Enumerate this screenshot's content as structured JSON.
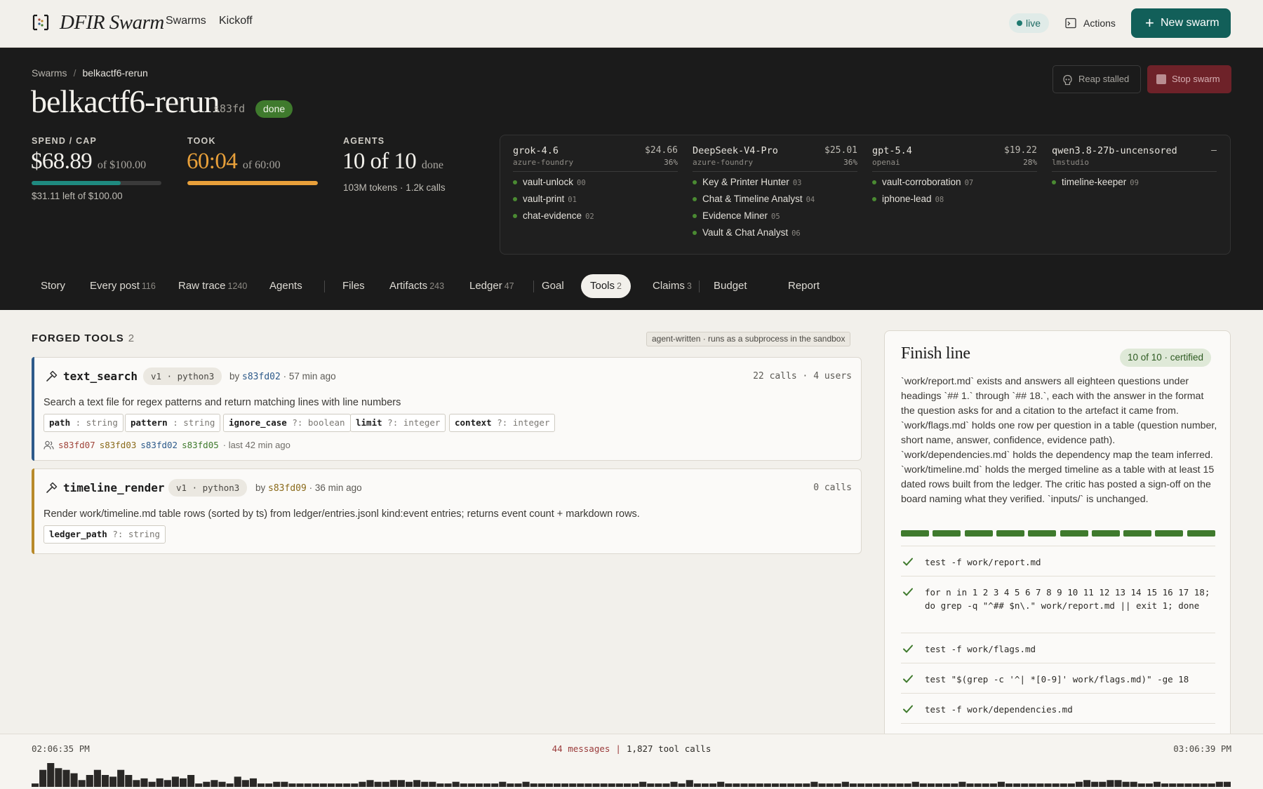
{
  "topbar": {
    "app_title": "DFIR Swarm",
    "nav": [
      "Swarms",
      "Kickoff"
    ],
    "live_label": "live",
    "actions_label": "Actions",
    "new_swarm_label": "New swarm"
  },
  "hero": {
    "breadcrumb": {
      "root": "Swarms",
      "sep": "/",
      "current": "belkactf6-rerun"
    },
    "title": "belkactf6-rerun",
    "swarm_id": "s83fd",
    "status": "done",
    "reap_label": "Reap stalled",
    "stop_label": "Stop swarm",
    "spend": {
      "label": "SPEND / CAP",
      "value": "$68.89",
      "of": "of $100.00",
      "sub": "$31.11 left of $100.00",
      "fraction": 0.6889,
      "color": "#1f8a80"
    },
    "took": {
      "label": "TOOK",
      "value": "60:04",
      "of": "of 60:00",
      "fraction": 1.0,
      "color": "#e8a03a"
    },
    "agents": {
      "label": "AGENTS",
      "value": "10 of 10",
      "of": "done",
      "sub": "103M tokens · 1.2k calls"
    },
    "providers": [
      {
        "name": "grok-4.6",
        "source": "azure-foundry",
        "cost": "$24.66",
        "pct": "36%",
        "agents": [
          {
            "name": "vault-unlock",
            "num": "00"
          },
          {
            "name": "vault-print",
            "num": "01"
          },
          {
            "name": "chat-evidence",
            "num": "02"
          }
        ]
      },
      {
        "name": "DeepSeek-V4-Pro",
        "source": "azure-foundry",
        "cost": "$25.01",
        "pct": "36%",
        "agents": [
          {
            "name": "Key & Printer Hunter",
            "num": "03"
          },
          {
            "name": "Chat & Timeline Analyst",
            "num": "04"
          },
          {
            "name": "Evidence Miner",
            "num": "05"
          },
          {
            "name": "Vault & Chat Analyst",
            "num": "06"
          }
        ]
      },
      {
        "name": "gpt-5.4",
        "source": "openai",
        "cost": "$19.22",
        "pct": "28%",
        "agents": [
          {
            "name": "vault-corroboration",
            "num": "07"
          },
          {
            "name": "iphone-lead",
            "num": "08"
          }
        ]
      },
      {
        "name": "qwen3.8-27b-uncensored",
        "source": "lmstudio",
        "cost": "–",
        "pct": "",
        "agents": [
          {
            "name": "timeline-keeper",
            "num": "09"
          }
        ]
      }
    ]
  },
  "tabs": [
    {
      "label": "Story",
      "count": ""
    },
    {
      "label": "Every post",
      "count": "116"
    },
    {
      "label": "Raw trace",
      "count": "1240"
    },
    {
      "label": "Agents",
      "count": ""
    },
    {
      "label": "Files",
      "count": ""
    },
    {
      "label": "Artifacts",
      "count": "243"
    },
    {
      "label": "Ledger",
      "count": "47"
    },
    {
      "label": "Goal",
      "count": ""
    },
    {
      "label": "Tools",
      "count": "2",
      "active": true
    },
    {
      "label": "Claims",
      "count": "3"
    },
    {
      "label": "Budget",
      "count": ""
    },
    {
      "label": "Report",
      "count": ""
    }
  ],
  "forged": {
    "heading": "FORGED TOOLS",
    "count": "2",
    "note": "agent-written · runs as a subprocess in the sandbox",
    "tools": [
      {
        "name": "text_search",
        "version": "v1 · python3",
        "by": "by",
        "author": "s83fd02",
        "author_color": "#2d5a8a",
        "age": "· 57 min ago",
        "calls": "22 calls · 4 users",
        "description": "Search a text file for regex patterns and return matching lines with line numbers",
        "params": [
          {
            "name": "path",
            "type": " : string"
          },
          {
            "name": "pattern",
            "type": " : string"
          },
          {
            "name": "ignore_case",
            "type": " ?: boolean"
          },
          {
            "name": "limit",
            "type": " ?: integer"
          },
          {
            "name": "context",
            "type": " ?: integer"
          }
        ],
        "users": [
          {
            "id": "s83fd07",
            "color": "#a0443a"
          },
          {
            "id": "s83fd03",
            "color": "#8a6a1a"
          },
          {
            "id": "s83fd02",
            "color": "#2d5a8a"
          },
          {
            "id": "s83fd05",
            "color": "#3f7a2d"
          }
        ],
        "last": "· last 42 min ago",
        "edge": "#2d5a8a"
      },
      {
        "name": "timeline_render",
        "version": "v1 · python3",
        "by": "by",
        "author": "s83fd09",
        "author_color": "#8a6a1a",
        "age": "· 36 min ago",
        "calls": "0 calls",
        "description": "Render work/timeline.md table rows (sorted by ts) from ledger/entries.jsonl kind:event entries; returns event count + markdown rows.",
        "params": [
          {
            "name": "ledger_path",
            "type": " ?: string"
          }
        ],
        "users": [],
        "last": "",
        "edge": "#b88a2a"
      }
    ]
  },
  "finish": {
    "title": "Finish line",
    "badge": "10 of 10 · certified",
    "description": "`work/report.md` exists and answers all eighteen questions under headings `## 1.` through `## 18.`, each with the answer in the format the question asks for and a citation to the artefact it came from. `work/flags.md` holds one row per question in a table (question number, short name, answer, confidence, evidence path). `work/dependencies.md` holds the dependency map the team inferred. `work/timeline.md` holds the merged timeline as a table with at least 15 dated rows built from the ledger. The critic has posted a sign-off on the board naming what they verified. `inputs/` is unchanged.",
    "segments_done": 10,
    "segments_total": 10,
    "checks": [
      "test -f work/report.md",
      "for n in 1 2 3 4 5 6 7 8 9 10 11 12 13 14 15 16 17 18; do grep -q \"^## $n\\.\" work/report.md || exit 1; done",
      "test -f work/flags.md",
      "test \"$(grep -c '^| *[0-9]' work/flags.md)\" -ge 18",
      "test -f work/dependencies.md"
    ]
  },
  "timeline": {
    "start": "02:06:35 PM",
    "end": "03:06:39 PM",
    "messages": "44 messages",
    "sep": "|",
    "tool_calls": "1,827 tool calls",
    "activity": [
      2,
      10,
      14,
      11,
      10,
      8,
      4,
      7,
      10,
      7,
      6,
      10,
      7,
      4,
      5,
      3,
      5,
      4,
      6,
      5,
      7,
      2,
      3,
      4,
      3,
      2,
      6,
      4,
      5,
      2,
      2,
      3,
      3,
      2,
      2,
      2,
      2,
      2,
      2,
      2,
      2,
      2,
      3,
      4,
      3,
      3,
      4,
      4,
      3,
      4,
      3,
      3,
      2,
      2,
      3,
      2,
      2,
      2,
      2,
      2,
      3,
      2,
      2,
      3,
      2,
      2,
      2,
      2,
      2,
      2,
      2,
      2,
      2,
      2,
      2,
      2,
      2,
      2,
      3,
      2,
      2,
      2,
      3,
      2,
      4,
      2,
      2,
      2,
      3,
      2,
      2,
      2,
      2,
      2,
      2,
      2,
      2,
      2,
      2,
      2,
      3,
      2,
      2,
      2,
      3,
      2,
      2,
      2,
      2,
      2,
      2,
      2,
      2,
      3,
      2,
      2,
      2,
      2,
      2,
      3,
      2,
      2,
      2,
      2,
      3,
      2,
      2,
      2,
      2,
      2,
      2,
      2,
      2,
      2,
      3,
      4,
      3,
      3,
      4,
      4,
      3,
      3,
      2,
      2,
      3,
      2,
      2,
      2,
      2,
      2,
      2,
      2,
      3,
      3
    ]
  }
}
